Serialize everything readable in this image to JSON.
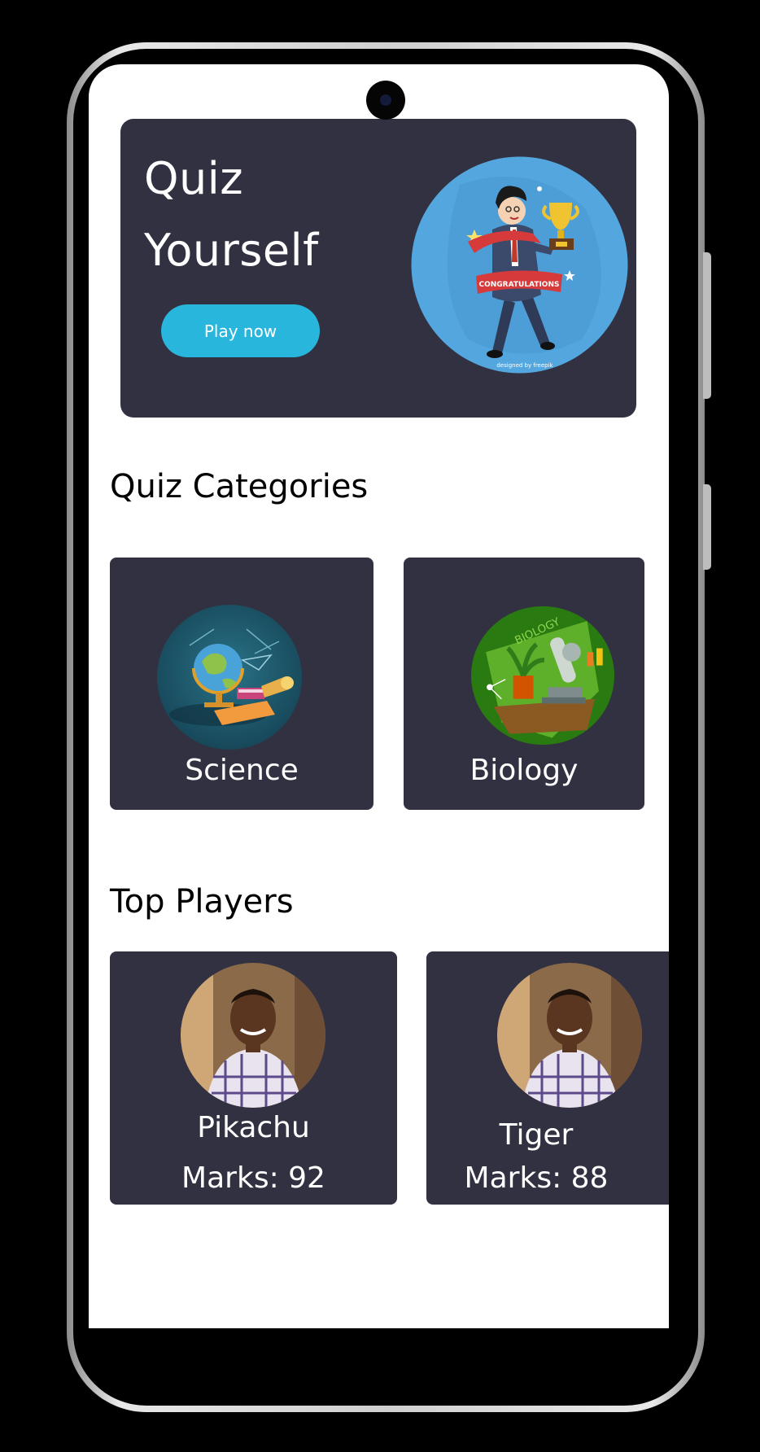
{
  "hero": {
    "title_line1": "Quiz",
    "title_line2": "Yourself",
    "play_button": "Play now",
    "banner_text": "CONGRATULATIONS",
    "credit": "designed by freepik"
  },
  "categories": {
    "title": "Quiz Categories",
    "items": [
      {
        "label": "Science",
        "icon": "science-globe-icon"
      },
      {
        "label": "Biology",
        "icon": "biology-microscope-icon",
        "art_text": "BIOLOGY"
      }
    ]
  },
  "players": {
    "title": "Top Players",
    "items": [
      {
        "name": "Pikachu",
        "marks": "Marks: 92"
      },
      {
        "name": "Tiger",
        "marks": "Marks: 88"
      }
    ]
  },
  "colors": {
    "card_bg": "#323141",
    "accent": "#29b6dd",
    "background": "#ffffff"
  }
}
